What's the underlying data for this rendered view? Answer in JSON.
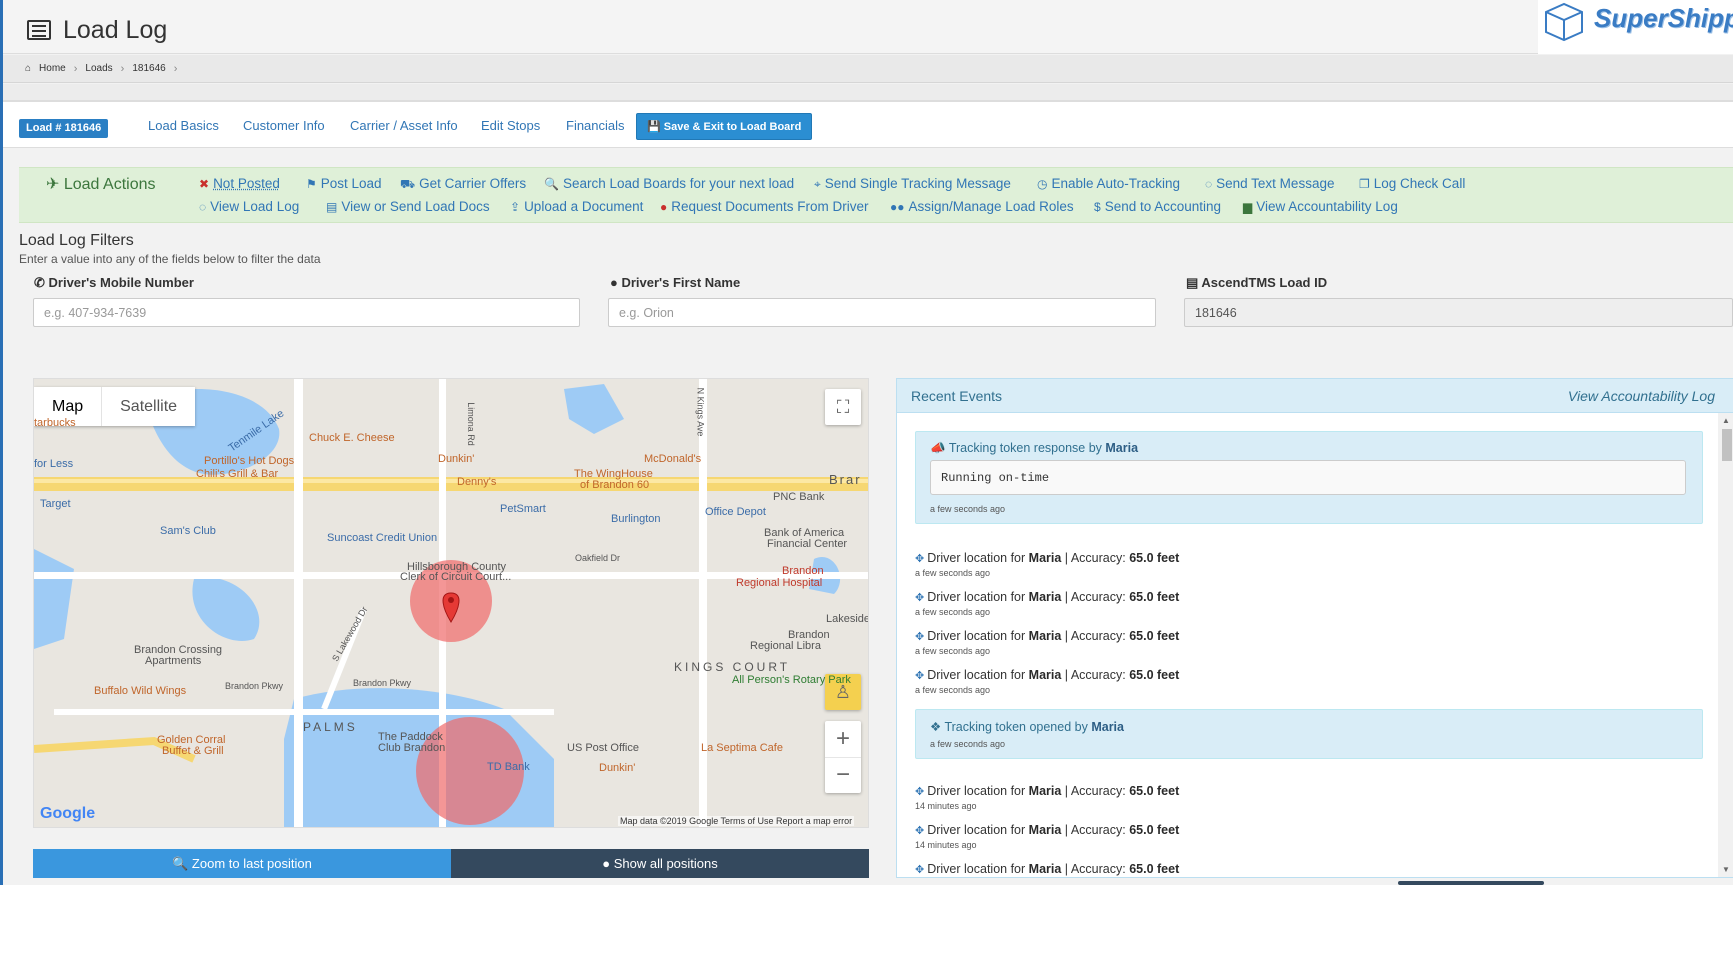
{
  "header": {
    "page_title": "Load Log",
    "logo_text": "SuperShippe"
  },
  "breadcrumb": [
    "Home",
    "Loads",
    "181646"
  ],
  "tabs": {
    "load_badge": "Load # 181646",
    "items": [
      "Load Basics",
      "Customer Info",
      "Carrier / Asset Info",
      "Edit Stops",
      "Financials"
    ],
    "save_label": "Save & Exit to Load Board"
  },
  "load_actions": {
    "heading": "Load Actions",
    "row1": [
      "Not Posted",
      "Post Load",
      "Get Carrier Offers",
      "Search Load Boards for your next load",
      "Send Single Tracking Message",
      "Enable Auto-Tracking",
      "Send Text Message",
      "Log Check Call"
    ],
    "row2": [
      "View Load Log",
      "View or Send Load Docs",
      "Upload a Document",
      "Request Documents From Driver",
      "Assign/Manage Load Roles",
      "Send to Accounting",
      "View Accountability Log"
    ]
  },
  "filters": {
    "title": "Load Log Filters",
    "subtitle": "Enter a value into any of the fields below to filter the data",
    "mobile_label": "Driver's Mobile Number",
    "mobile_placeholder": "e.g. 407-934-7639",
    "first_name_label": "Driver's First Name",
    "first_name_placeholder": "e.g. Orion",
    "load_id_label": "AscendTMS Load ID",
    "load_id_value": "181646"
  },
  "map": {
    "type_map": "Map",
    "type_satellite": "Satellite",
    "labels": {
      "tenmile_lake": "Tenmile Lake",
      "chuck_e_cheese": "Chuck E. Cheese",
      "portillos": "Portillo's Hot Dogs",
      "chilis": "Chili's Grill & Bar",
      "dunkin1": "Dunkin'",
      "dennys": "Denny's",
      "mcdonalds": "McDonald's",
      "winghouse": "The WingHouse",
      "winghouse2": "of Brandon 60",
      "petsmart": "PetSmart",
      "burlington": "Burlington",
      "office_depot": "Office Depot",
      "pnc": "PNC Bank",
      "boa1": "Bank of America",
      "boa2": "Financial Center",
      "sams": "Sam's Club",
      "target": "Target",
      "for_less": "for Less",
      "starbucks": "tarbucks",
      "suncoast": "Suncoast Credit Union",
      "hillsborough1": "Hillsborough County",
      "hillsborough2": "Clerk of Circuit Court...",
      "oakfield": "Oakfield Dr",
      "brandon_hosp1": "Brandon",
      "brandon_hosp2": "Regional Hospital",
      "lakeside": "Lakeside C",
      "brandon_lib1": "Brandon",
      "brandon_lib2": "Regional Libra",
      "kings_court": "KINGS COURT",
      "rotary": "All Person's Rotary Park",
      "brandon_crossing1": "Brandon Crossing",
      "brandon_crossing2": "Apartments",
      "buffalo": "Buffalo Wild Wings",
      "brandon_pkwy": "Brandon Pkwy",
      "brandon_pkwy2": "Brandon Pkwy",
      "palms": "PALMS",
      "paddock1": "The Paddock",
      "paddock2": "Club Brandon",
      "golden1": "Golden Corral",
      "golden2": "Buffet & Grill",
      "td": "TD Bank",
      "usps": "US Post Office",
      "dunkin2": "Dunkin'",
      "la_septima": "La Septima Cafe",
      "s_lakewood": "S Lakewood Dr",
      "bra": "Brar",
      "limona": "Limona Rd",
      "kings_ave": "N Kings Ave"
    },
    "footer": "Map data ©2019 Google    Terms of Use    Report a map error",
    "google": "Google",
    "zoom_label": "Zoom to last position",
    "show_all_label": "Show all positions"
  },
  "recent_events": {
    "title": "Recent Events",
    "link": "View Accountability Log",
    "items": [
      {
        "kind": "box",
        "text": "Tracking token response by",
        "user": "Maria",
        "detail": "Running on-time",
        "ago": "a few seconds ago"
      },
      {
        "kind": "row",
        "text": "Driver location for",
        "user": "Maria",
        "sep": "| Accuracy:",
        "acc": "65.0 feet",
        "ago": "a few seconds ago"
      },
      {
        "kind": "row",
        "text": "Driver location for",
        "user": "Maria",
        "sep": "| Accuracy:",
        "acc": "65.0 feet",
        "ago": "a few seconds ago"
      },
      {
        "kind": "row",
        "text": "Driver location for",
        "user": "Maria",
        "sep": "| Accuracy:",
        "acc": "65.0 feet",
        "ago": "a few seconds ago"
      },
      {
        "kind": "row",
        "text": "Driver location for",
        "user": "Maria",
        "sep": "| Accuracy:",
        "acc": "65.0 feet",
        "ago": "a few seconds ago"
      },
      {
        "kind": "box",
        "text": "Tracking token opened by",
        "user": "Maria",
        "ago": "a few seconds ago"
      },
      {
        "kind": "row",
        "text": "Driver location for",
        "user": "Maria",
        "sep": "| Accuracy:",
        "acc": "65.0 feet",
        "ago": "14 minutes ago"
      },
      {
        "kind": "row",
        "text": "Driver location for",
        "user": "Maria",
        "sep": "| Accuracy:",
        "acc": "65.0 feet",
        "ago": "14 minutes ago"
      },
      {
        "kind": "row",
        "text": "Driver location for",
        "user": "Maria",
        "sep": "| Accuracy:",
        "acc": "65.0 feet",
        "ago": ""
      }
    ]
  },
  "colors": {
    "link": "#3176b5",
    "actions_bg": "#dff0d8",
    "info_bg": "#d9edf7",
    "primary": "#3a97de",
    "dark": "#34495e",
    "map_marker": "#e53935"
  }
}
